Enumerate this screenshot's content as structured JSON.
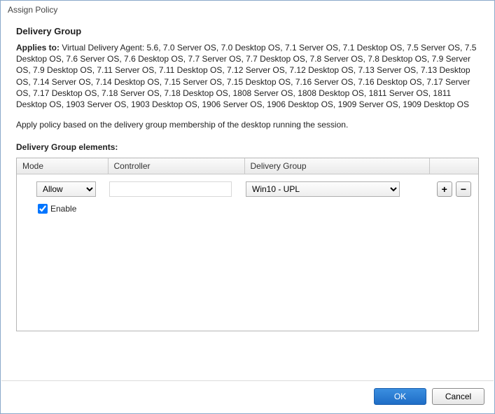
{
  "window": {
    "title": "Assign Policy"
  },
  "section": {
    "heading": "Delivery Group",
    "applies_label": "Applies to:",
    "applies_text": "Virtual Delivery Agent: 5.6, 7.0 Server OS, 7.0 Desktop OS, 7.1 Server OS, 7.1 Desktop OS, 7.5 Server OS, 7.5 Desktop OS, 7.6 Server OS, 7.6 Desktop OS, 7.7 Server OS, 7.7 Desktop OS, 7.8 Server OS, 7.8 Desktop OS, 7.9 Server OS, 7.9 Desktop OS, 7.11 Server OS, 7.11 Desktop OS, 7.12 Server OS, 7.12 Desktop OS, 7.13 Server OS, 7.13 Desktop OS, 7.14 Server OS, 7.14 Desktop OS, 7.15 Server OS, 7.15 Desktop OS, 7.16 Server OS, 7.16 Desktop OS, 7.17 Server OS, 7.17 Desktop OS, 7.18 Server OS, 7.18 Desktop OS, 1808 Server OS, 1808 Desktop OS, 1811 Server OS, 1811 Desktop OS, 1903 Server OS, 1903 Desktop OS, 1906 Server OS, 1906 Desktop OS, 1909 Server OS, 1909 Desktop OS",
    "description": "Apply policy based on the delivery group membership of the desktop running the session.",
    "elements_heading": "Delivery Group elements:"
  },
  "grid": {
    "columns": {
      "mode": "Mode",
      "controller": "Controller",
      "delivery_group": "Delivery Group"
    },
    "row": {
      "mode_value": "Allow",
      "controller_value": "",
      "delivery_group_value": "Win10 - UPL",
      "enable_label": "Enable",
      "enable_checked": true
    },
    "buttons": {
      "add": "+",
      "remove": "−"
    }
  },
  "footer": {
    "ok": "OK",
    "cancel": "Cancel"
  }
}
